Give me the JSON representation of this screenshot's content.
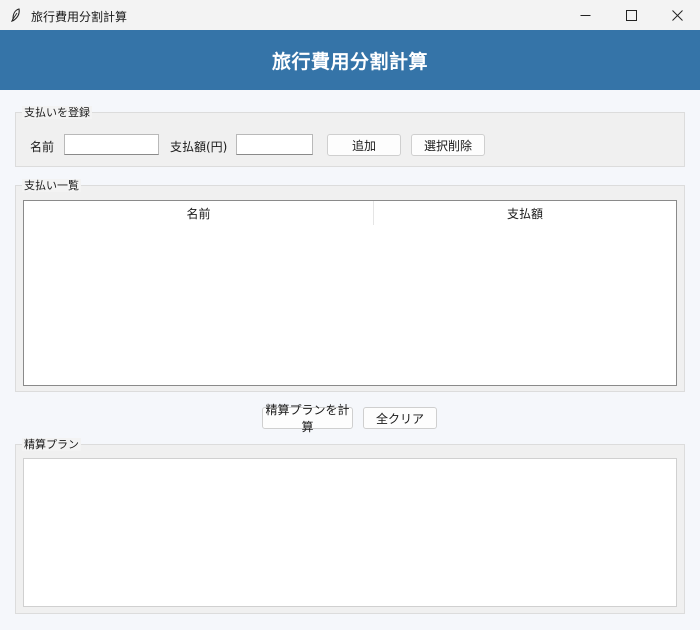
{
  "window": {
    "title": "旅行費用分割計算",
    "icon": "feather-icon"
  },
  "header": {
    "title": "旅行費用分割計算",
    "color": "#3574a8"
  },
  "register": {
    "group_label": "支払いを登録",
    "name_label": "名前",
    "name_value": "",
    "amount_label": "支払額(円)",
    "amount_value": "",
    "add_button": "追加",
    "delete_button": "選択削除"
  },
  "list": {
    "group_label": "支払い一覧",
    "columns": [
      "名前",
      "支払額"
    ],
    "rows": []
  },
  "actions": {
    "calculate_button": "精算プランを計算",
    "clear_button": "全クリア"
  },
  "plan": {
    "group_label": "精算プラン",
    "text": ""
  }
}
